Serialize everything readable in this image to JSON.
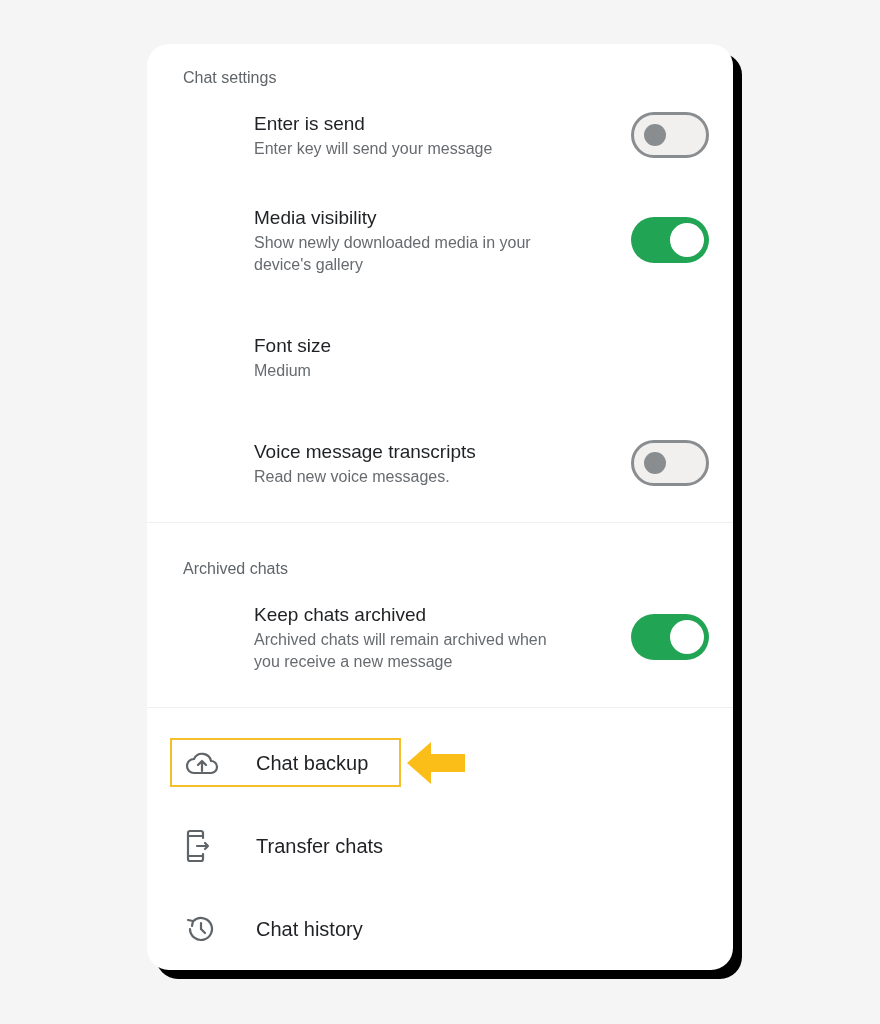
{
  "sections": [
    {
      "header": "Chat settings",
      "items": [
        {
          "kind": "toggle",
          "title": "Enter is send",
          "subtitle": "Enter key will send your message",
          "on": false
        },
        {
          "kind": "toggle",
          "title": "Media visibility",
          "subtitle": "Show newly downloaded media in your device's gallery",
          "on": true
        },
        {
          "kind": "value",
          "title": "Font size",
          "subtitle": "Medium"
        },
        {
          "kind": "toggle",
          "title": "Voice message transcripts",
          "subtitle": "Read new voice messages.",
          "on": false
        }
      ]
    },
    {
      "header": "Archived chats",
      "items": [
        {
          "kind": "toggle",
          "title": "Keep chats archived",
          "subtitle": "Archived chats will remain archived when you receive a new message",
          "on": true
        }
      ]
    }
  ],
  "links": [
    {
      "kind": "backup",
      "label": "Chat backup",
      "highlighted": true
    },
    {
      "kind": "transfer",
      "label": "Transfer chats",
      "highlighted": false
    },
    {
      "kind": "history",
      "label": "Chat history",
      "highlighted": false
    }
  ]
}
